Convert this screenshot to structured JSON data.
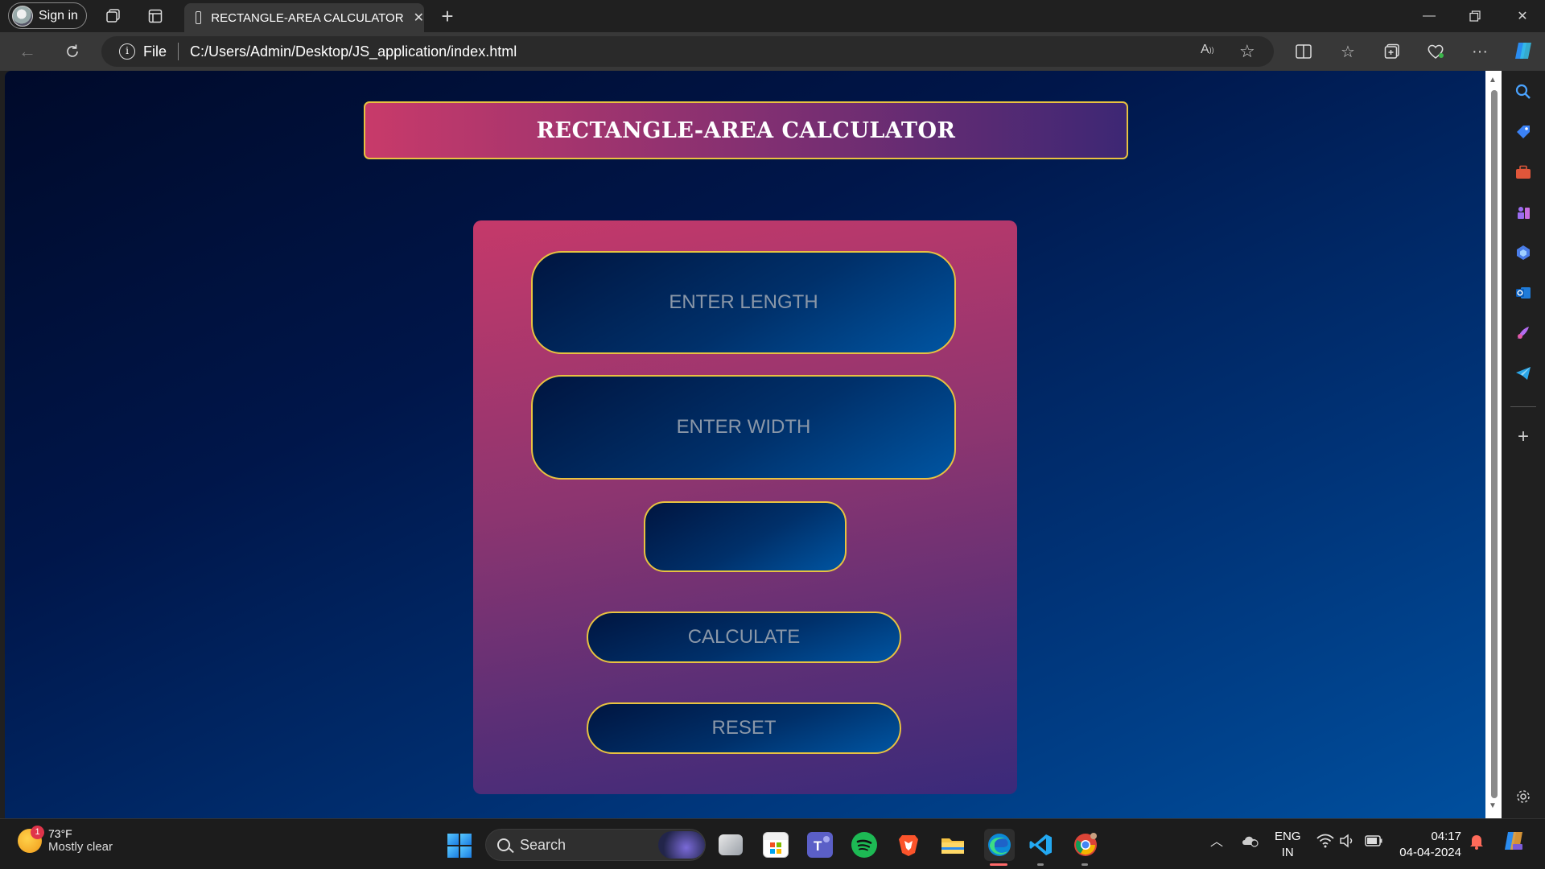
{
  "browser": {
    "signin_label": "Sign in",
    "tab_title": "RECTANGLE-AREA CALCULATOR",
    "address_protocol": "File",
    "address_url": "C:/Users/Admin/Desktop/JS_application/index.html"
  },
  "page": {
    "heading": "RECTANGLE-AREA CALCULATOR",
    "length_placeholder": "ENTER LENGTH",
    "width_placeholder": "ENTER WIDTH",
    "result_value": "",
    "calculate_label": "CALCULATE",
    "reset_label": "RESET"
  },
  "colors": {
    "accent_border": "#e8c240",
    "card_top": "#c5396a",
    "card_bottom": "#3a2a7a",
    "field_dark": "#001540",
    "field_light": "#0055a2"
  },
  "taskbar": {
    "weather_badge": "1",
    "temperature": "73°F",
    "condition": "Mostly clear",
    "search_label": "Search",
    "language": "ENG",
    "region": "IN",
    "time": "04:17",
    "date": "04-04-2024",
    "apps": [
      "start-icon",
      "search-icon",
      "task-view-icon",
      "store-icon",
      "teams-icon",
      "spotify-icon",
      "brave-icon",
      "file-explorer-icon",
      "edge-icon",
      "vscode-icon",
      "chrome-icon"
    ]
  }
}
